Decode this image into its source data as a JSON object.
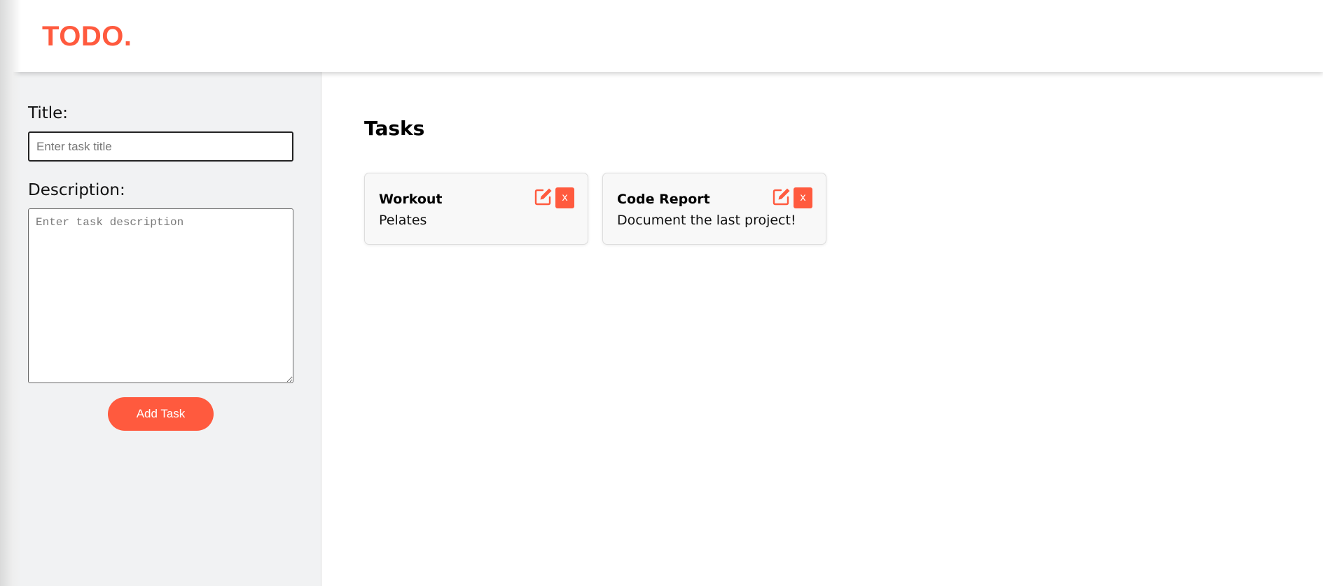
{
  "header": {
    "logo": "TODO."
  },
  "form": {
    "title_label": "Title:",
    "title_placeholder": "Enter task title",
    "title_value": "",
    "description_label": "Description:",
    "description_placeholder": "Enter task description",
    "description_value": "",
    "add_button_label": "Add Task"
  },
  "main": {
    "heading": "Tasks",
    "tasks": [
      {
        "title": "Workout",
        "description": "Pelates",
        "edit_icon": "edit-icon",
        "delete_label": "x"
      },
      {
        "title": "Code Report",
        "description": "Document the last project!",
        "edit_icon": "edit-icon",
        "delete_label": "x"
      }
    ]
  },
  "colors": {
    "accent": "#ff5a3e",
    "sidebar_bg": "#f1f2f3",
    "card_bg": "#f8f8f8"
  }
}
